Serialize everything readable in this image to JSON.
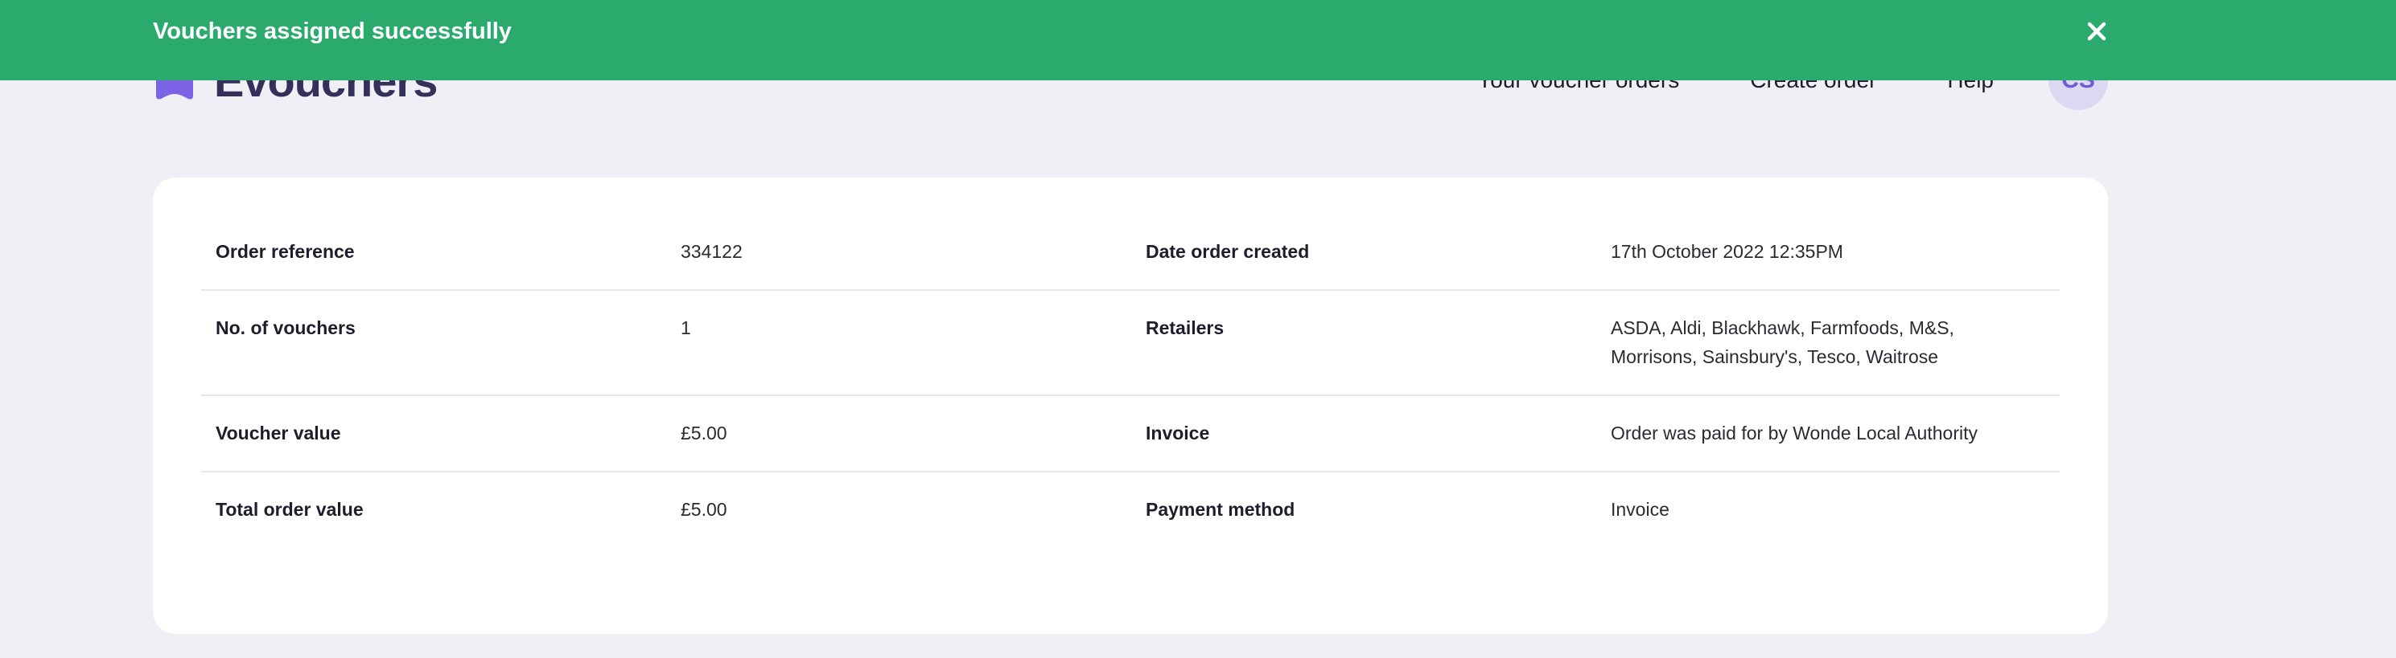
{
  "toast": {
    "message": "Vouchers assigned successfully",
    "close_icon": "close-icon",
    "background": "#2aaa6d"
  },
  "header": {
    "brand_name": "Evouchers",
    "brand_color": "#7b63e6",
    "nav": [
      {
        "label": "Your voucher orders"
      },
      {
        "label": "Create order"
      },
      {
        "label": "Help"
      }
    ],
    "avatar_initials": "CS"
  },
  "order": {
    "rows": [
      {
        "left_label": "Order reference",
        "left_value": "334122",
        "right_label": "Date order created",
        "right_value": "17th October 2022 12:35PM"
      },
      {
        "left_label": "No. of vouchers",
        "left_value": "1",
        "right_label": "Retailers",
        "right_value": "ASDA, Aldi, Blackhawk, Farmfoods, M&S, Morrisons, Sainsbury's, Tesco, Waitrose"
      },
      {
        "left_label": "Voucher value",
        "left_value": "£5.00",
        "right_label": "Invoice",
        "right_value": "Order was paid for by Wonde Local Authority"
      },
      {
        "left_label": "Total order value",
        "left_value": "£5.00",
        "right_label": "Payment method",
        "right_value": "Invoice"
      }
    ]
  }
}
